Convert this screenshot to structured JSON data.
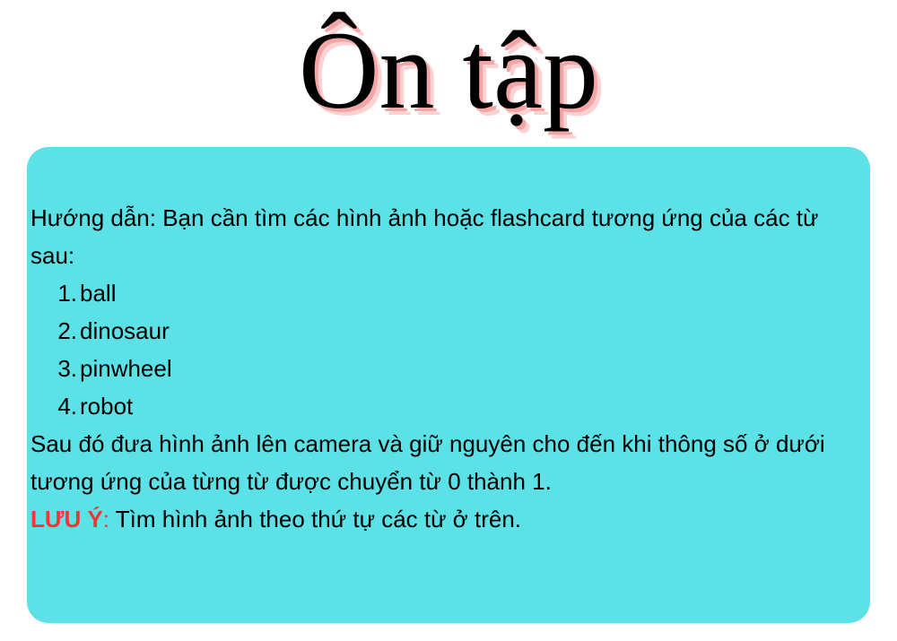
{
  "title": "Ôn tập",
  "instructions": {
    "intro": "Hướng dẫn: Bạn cần tìm các hình ảnh hoặc flashcard tương ứng của các từ sau:",
    "words": [
      {
        "num": "1.",
        "text": "ball"
      },
      {
        "num": "2.",
        "text": "dinosaur"
      },
      {
        "num": "3.",
        "text": "pinwheel"
      },
      {
        "num": "4.",
        "text": "robot"
      }
    ],
    "outro": "Sau đó đưa hình ảnh lên camera và giữ nguyên cho đến khi thông số ở dưới tương ứng của từng từ được chuyển từ 0 thành 1.",
    "note_label": "LƯU Ý",
    "note_colon": ":",
    "note_text": " Tìm hình ảnh theo thứ tự các từ ở trên."
  },
  "colors": {
    "card_background": "#5ce1e6",
    "note_label": "#ff3131",
    "title_shadow": "#f4a6a6"
  }
}
